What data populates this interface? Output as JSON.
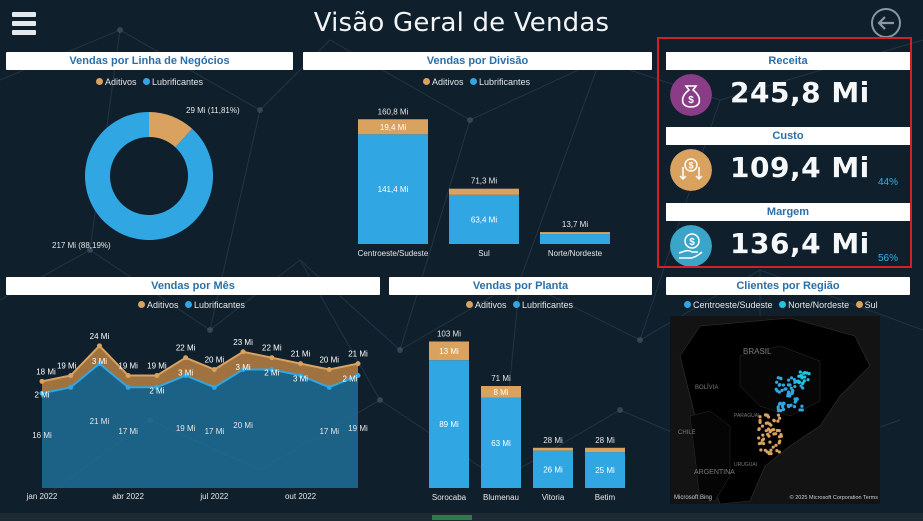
{
  "page": {
    "title": "Visão Geral de Vendas"
  },
  "icons": {
    "menu": "hamburger-menu-icon",
    "back": "back-arrow-icon"
  },
  "colors": {
    "aditivos": "#d9a25f",
    "lubrificantes": "#30a7e3",
    "norte_nordeste": "#1ec8e0",
    "highlight": "#d0202a"
  },
  "panels": {
    "linha_negocios": {
      "title": "Vendas por Linha de Negócios"
    },
    "divisao": {
      "title": "Vendas por Divisão"
    },
    "mes": {
      "title": "Vendas por Mês"
    },
    "planta": {
      "title": "Vendas por Planta"
    },
    "clientes": {
      "title": "Clientes por Região"
    }
  },
  "legend": {
    "aditivos": "Aditivos",
    "lubrificantes": "Lubrificantes"
  },
  "legend_regiao": {
    "centro": "Centroeste/Sudeste",
    "norte": "Norte/Nordeste",
    "sul": "Sul"
  },
  "kpis": {
    "receita": {
      "label": "Receita",
      "value": "245,8 Mi",
      "icon": "money-bag-icon"
    },
    "custo": {
      "label": "Custo",
      "value": "109,4 Mi",
      "pct": "44%",
      "icon": "cost-down-icon"
    },
    "margem": {
      "label": "Margem",
      "value": "136,4 Mi",
      "pct": "56%",
      "icon": "hand-coin-icon"
    }
  },
  "map": {
    "countries": [
      "BRASIL",
      "BOLÍVIA",
      "PARAGUAI",
      "CHILE",
      "ARGENTINA",
      "URUGUAI"
    ],
    "credit_left": "Microsoft Bing",
    "credit_right": "© 2025 Microsoft Corporation  Terms"
  },
  "chart_data": [
    {
      "type": "pie",
      "title": "Vendas por Linha de Negócios",
      "categories": [
        "Aditivos",
        "Lubrificantes"
      ],
      "values": [
        29,
        217
      ],
      "data_labels": [
        "29 Mi (11,81%)",
        "217 Mi (88,19%)"
      ],
      "legend": "top"
    },
    {
      "type": "bar",
      "title": "Vendas por Divisão",
      "categories": [
        "Centroeste/Sudeste",
        "Sul",
        "Norte/Nordeste"
      ],
      "series": [
        {
          "name": "Lubrificantes",
          "values": [
            141.4,
            63.4,
            12.8
          ],
          "labels": [
            "141,4 Mi",
            "63,4 Mi",
            ""
          ]
        },
        {
          "name": "Aditivos",
          "values": [
            19.4,
            7.9,
            0.9
          ],
          "labels": [
            "19,4 Mi",
            "",
            ""
          ]
        }
      ],
      "totals": [
        "160,8 Mi",
        "71,3 Mi",
        "13,7 Mi"
      ],
      "ylim": [
        0,
        165
      ]
    },
    {
      "type": "area",
      "title": "Vendas por Mês",
      "x": [
        "jan 2022",
        "fev 2022",
        "mar 2022",
        "abr 2022",
        "mai 2022",
        "jun 2022",
        "jul 2022",
        "ago 2022",
        "set 2022",
        "out 2022",
        "nov 2022",
        "dez 2022"
      ],
      "x_ticks": [
        "jan 2022",
        "abr 2022",
        "jul 2022",
        "out 2022"
      ],
      "series": [
        {
          "name": "Lubrificantes",
          "values": [
            16,
            17,
            21,
            17,
            17,
            19,
            17,
            20,
            20,
            19,
            17,
            19
          ],
          "labels": [
            "16 Mi",
            "",
            "21 Mi",
            "17 Mi",
            "",
            "19 Mi",
            "17 Mi",
            "20 Mi",
            "",
            "",
            "17 Mi",
            "19 Mi"
          ]
        },
        {
          "name": "Aditivos",
          "values": [
            2,
            2,
            3,
            2,
            2,
            3,
            3,
            3,
            2,
            3,
            3,
            2
          ],
          "labels": [
            "2 Mi",
            "",
            "3 Mi",
            "",
            "2 Mi",
            "3 Mi",
            "",
            "3 Mi",
            "2 Mi",
            "3 Mi",
            "",
            "2 Mi"
          ]
        }
      ],
      "totals": [
        18,
        19,
        24,
        19,
        19,
        22,
        20,
        23,
        22,
        21,
        20,
        21
      ],
      "total_labels": [
        "18 Mi",
        "19 Mi",
        "24 Mi",
        "19 Mi",
        "19 Mi",
        "22 Mi",
        "20 Mi",
        "23 Mi",
        "22 Mi",
        "21 Mi",
        "20 Mi",
        "21 Mi"
      ]
    },
    {
      "type": "bar",
      "title": "Vendas por Planta",
      "categories": [
        "Sorocaba",
        "Blumenau",
        "Vitoria",
        "Betim"
      ],
      "series": [
        {
          "name": "Lubrificantes",
          "values": [
            89,
            63,
            26,
            25
          ],
          "labels": [
            "89 Mi",
            "63 Mi",
            "26 Mi",
            "25 Mi"
          ]
        },
        {
          "name": "Aditivos",
          "values": [
            13,
            8,
            2,
            3
          ],
          "labels": [
            "13 Mi",
            "8 Mi",
            "",
            ""
          ]
        }
      ],
      "totals": [
        "103 Mi",
        "71 Mi",
        "28 Mi",
        "28 Mi"
      ],
      "ylim": [
        0,
        110
      ]
    }
  ]
}
